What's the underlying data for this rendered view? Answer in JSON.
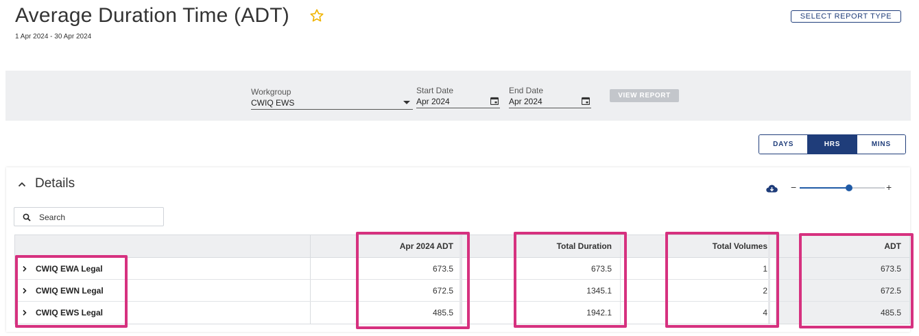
{
  "header": {
    "title": "Average Duration Time (ADT)",
    "date_range": "1 Apr 2024 - 30 Apr 2024",
    "select_report_type": "SELECT REPORT TYPE"
  },
  "filters": {
    "workgroup_label": "Workgroup",
    "workgroup_value": "CWIQ EWS",
    "start_label": "Start Date",
    "start_value": "Apr 2024",
    "end_label": "End Date",
    "end_value": "Apr 2024",
    "view_report": "VIEW REPORT"
  },
  "units": {
    "days": "DAYS",
    "hrs": "HRS",
    "mins": "MINS",
    "selected": "HRS"
  },
  "details": {
    "title": "Details",
    "search_placeholder": "Search",
    "zoom_level": 0.58,
    "columns": [
      "",
      "Apr 2024 ADT",
      "Total Duration",
      "Total Volumes",
      "ADT"
    ],
    "rows": [
      {
        "name": "CWIQ EWA Legal",
        "apr_adt": "673.5",
        "total_duration": "673.5",
        "total_volumes": "1",
        "adt": "673.5"
      },
      {
        "name": "CWIQ EWN Legal",
        "apr_adt": "672.5",
        "total_duration": "1345.1",
        "total_volumes": "2",
        "adt": "672.5"
      },
      {
        "name": "CWIQ EWS Legal",
        "apr_adt": "485.5",
        "total_duration": "1942.1",
        "total_volumes": "4",
        "adt": "485.5"
      }
    ]
  },
  "colors": {
    "accent": "#1f3d7a",
    "highlight": "#d6317f",
    "star": "#f0b400"
  }
}
